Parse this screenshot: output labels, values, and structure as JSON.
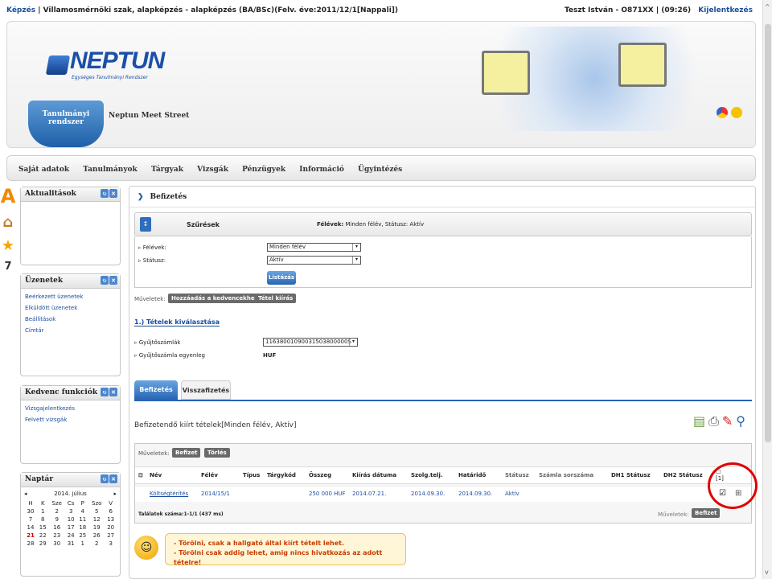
{
  "topbar": {
    "left_link": "Képzés",
    "left_text": "| Villamosmérnöki szak, alapképzés - alapképzés (BA/BSc)(Felv. éve:2011/12/1[Nappali])",
    "user": "Teszt István - O871XX | (09:26)",
    "logout": "Kijelentkezés"
  },
  "header": {
    "logo": "NEPTUN",
    "logo_sub": "Egységes Tanulmányi Rendszer",
    "tab": "Tanulmányi rendszer",
    "meet": "Neptun Meet Street"
  },
  "menu": [
    "Saját adatok",
    "Tanulmányok",
    "Tárgyak",
    "Vizsgák",
    "Pénzügyek",
    "Információ",
    "Ügyintézés"
  ],
  "side": {
    "aktualitasok": {
      "title": "Aktualitások"
    },
    "uzenetek": {
      "title": "Üzenetek",
      "items": [
        "Beérkezett üzenetek",
        "Elküldött üzenetek",
        "Beállítások",
        "Címtár"
      ]
    },
    "kedvenc": {
      "title": "Kedvenc funkciók",
      "items": [
        "Vizsgajelentkezés",
        "Felvett vizsgák"
      ]
    },
    "naptar": {
      "title": "Naptár",
      "month": "2014. július",
      "days": [
        "H",
        "K",
        "Sze",
        "Cs",
        "P",
        "Szo",
        "V"
      ],
      "weeks": [
        [
          "30",
          "1",
          "2",
          "3",
          "4",
          "5",
          "6"
        ],
        [
          "7",
          "8",
          "9",
          "10",
          "11",
          "12",
          "13"
        ],
        [
          "14",
          "15",
          "16",
          "17",
          "18",
          "19",
          "20"
        ],
        [
          "21",
          "22",
          "23",
          "24",
          "25",
          "26",
          "27"
        ],
        [
          "28",
          "29",
          "30",
          "31",
          "1",
          "2",
          "3"
        ]
      ]
    }
  },
  "page": {
    "title": "Befizetés",
    "filter_label": "Szűrések",
    "filter_summary_label": "Félévek:",
    "filter_summary": "Minden félév, Státusz: Aktív",
    "felevek_label": "Félévek:",
    "felevek_value": "Minden félév",
    "statusz_label": "Státusz:",
    "statusz_value": "Aktív",
    "listazas": "Listázás",
    "muveletek": "Műveletek:",
    "add_fav": "Hozzáadás a kedvencekhez",
    "print": "Tétel kiírás",
    "step1": "1.) Tételek kiválasztása",
    "gyujto_label": "Gyűjtőszámlák",
    "gyujto_value": "11638001090031503800000S",
    "gyujto_egy_label": "Gyűjtőszámla egyenleg",
    "gyujto_egy_value": "HUF",
    "tab_befizetes": "Befizetés",
    "tab_visszafizetes": "Visszafizetés",
    "list_title": "Befizetendő kiírt tételek[Minden félév, Aktív]",
    "tbl_muveletek": "Műveletek:",
    "btn_befizet": "Befizet",
    "btn_torles": "Törlés",
    "columns": [
      "Név",
      "Félév",
      "Típus",
      "Tárgykód",
      "Összeg",
      "Kiírás dátuma",
      "Szolg.telj.",
      "Határidő",
      "Státusz",
      "Számla sorszáma",
      "DH1 Státusz",
      "DH2 Státusz"
    ],
    "row": {
      "nev": "Költségtérítés",
      "felev": "2014/15/1",
      "osszeg": "250 000 HUF",
      "kiiras": "2014.07.21.",
      "szolg": "2014.09.30.",
      "hatarido": "2014.09.30.",
      "statusz": "Aktív"
    },
    "sel_count": "[1]",
    "found": "Találatok száma:1-1/1 (437 ms)",
    "bottom_muveletek": "Műveletek:",
    "bottom_befizet": "Befizet",
    "note1": "- Törölni, csak a hallgató által kiírt tételt lehet.",
    "note2": "- Törölni csak addig lehet, amig nincs hivatkozás az adott tételre!"
  },
  "colors": {
    "accent": "#1f5fa8",
    "link": "#1a4d9e",
    "warn": "#c83c00",
    "highlight": "#e00000"
  }
}
